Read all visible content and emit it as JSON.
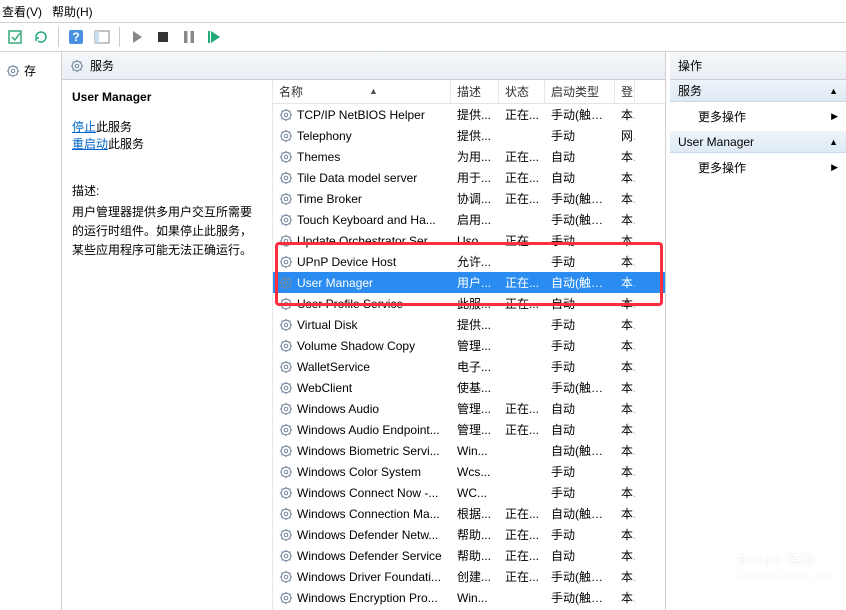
{
  "menu": {
    "view": "查看(V)",
    "help": "帮助(H)"
  },
  "leftnav": {
    "item1": "存"
  },
  "pane": {
    "title": "服务",
    "selected_name": "User Manager",
    "link_stop": "停止",
    "link_stop_suffix": "此服务",
    "link_restart": "重启动",
    "link_restart_suffix": "此服务",
    "desc_label": "描述:",
    "desc_text": "用户管理器提供多用户交互所需要的运行时组件。如果停止此服务，某些应用程序可能无法正确运行。"
  },
  "columns": {
    "name": "名称",
    "desc": "描述",
    "status": "状态",
    "startup": "启动类型",
    "logon": "登"
  },
  "services": [
    {
      "name": "TCP/IP NetBIOS Helper",
      "desc": "提供...",
      "status": "正在...",
      "startup": "手动(触发...",
      "logon": "本"
    },
    {
      "name": "Telephony",
      "desc": "提供...",
      "status": "",
      "startup": "手动",
      "logon": "网"
    },
    {
      "name": "Themes",
      "desc": "为用...",
      "status": "正在...",
      "startup": "自动",
      "logon": "本"
    },
    {
      "name": "Tile Data model server",
      "desc": "用于...",
      "status": "正在...",
      "startup": "自动",
      "logon": "本"
    },
    {
      "name": "Time Broker",
      "desc": "协调...",
      "status": "正在...",
      "startup": "手动(触发...",
      "logon": "本"
    },
    {
      "name": "Touch Keyboard and Ha...",
      "desc": "启用...",
      "status": "",
      "startup": "手动(触发...",
      "logon": "本"
    },
    {
      "name": "Update Orchestrator Ser...",
      "desc": "Uso...",
      "status": "正在...",
      "startup": "手动",
      "logon": "本"
    },
    {
      "name": "UPnP Device Host",
      "desc": "允许...",
      "status": "",
      "startup": "手动",
      "logon": "本"
    },
    {
      "name": "User Manager",
      "desc": "用户...",
      "status": "正在...",
      "startup": "自动(触发...",
      "logon": "本",
      "selected": true
    },
    {
      "name": "User Profile Service",
      "desc": "此服...",
      "status": "正在...",
      "startup": "自动",
      "logon": "本"
    },
    {
      "name": "Virtual Disk",
      "desc": "提供...",
      "status": "",
      "startup": "手动",
      "logon": "本"
    },
    {
      "name": "Volume Shadow Copy",
      "desc": "管理...",
      "status": "",
      "startup": "手动",
      "logon": "本"
    },
    {
      "name": "WalletService",
      "desc": "电子...",
      "status": "",
      "startup": "手动",
      "logon": "本"
    },
    {
      "name": "WebClient",
      "desc": "使基...",
      "status": "",
      "startup": "手动(触发...",
      "logon": "本"
    },
    {
      "name": "Windows Audio",
      "desc": "管理...",
      "status": "正在...",
      "startup": "自动",
      "logon": "本"
    },
    {
      "name": "Windows Audio Endpoint...",
      "desc": "管理...",
      "status": "正在...",
      "startup": "自动",
      "logon": "本"
    },
    {
      "name": "Windows Biometric Servi...",
      "desc": "Win...",
      "status": "",
      "startup": "自动(触发...",
      "logon": "本"
    },
    {
      "name": "Windows Color System",
      "desc": "Wcs...",
      "status": "",
      "startup": "手动",
      "logon": "本"
    },
    {
      "name": "Windows Connect Now -...",
      "desc": "WC...",
      "status": "",
      "startup": "手动",
      "logon": "本"
    },
    {
      "name": "Windows Connection Ma...",
      "desc": "根据...",
      "status": "正在...",
      "startup": "自动(触发...",
      "logon": "本"
    },
    {
      "name": "Windows Defender Netw...",
      "desc": "帮助...",
      "status": "正在...",
      "startup": "手动",
      "logon": "本"
    },
    {
      "name": "Windows Defender Service",
      "desc": "帮助...",
      "status": "正在...",
      "startup": "自动",
      "logon": "本"
    },
    {
      "name": "Windows Driver Foundati...",
      "desc": "创建...",
      "status": "正在...",
      "startup": "手动(触发...",
      "logon": "本"
    },
    {
      "name": "Windows Encryption Pro...",
      "desc": "Win...",
      "status": "",
      "startup": "手动(触发...",
      "logon": "本"
    }
  ],
  "actions": {
    "title": "操作",
    "sec1": "服务",
    "more1": "更多操作",
    "sec2": "User Manager",
    "more2": "更多操作"
  },
  "watermark": {
    "brand": "Baidu 经验",
    "url": "jingyan.baidu.com"
  }
}
